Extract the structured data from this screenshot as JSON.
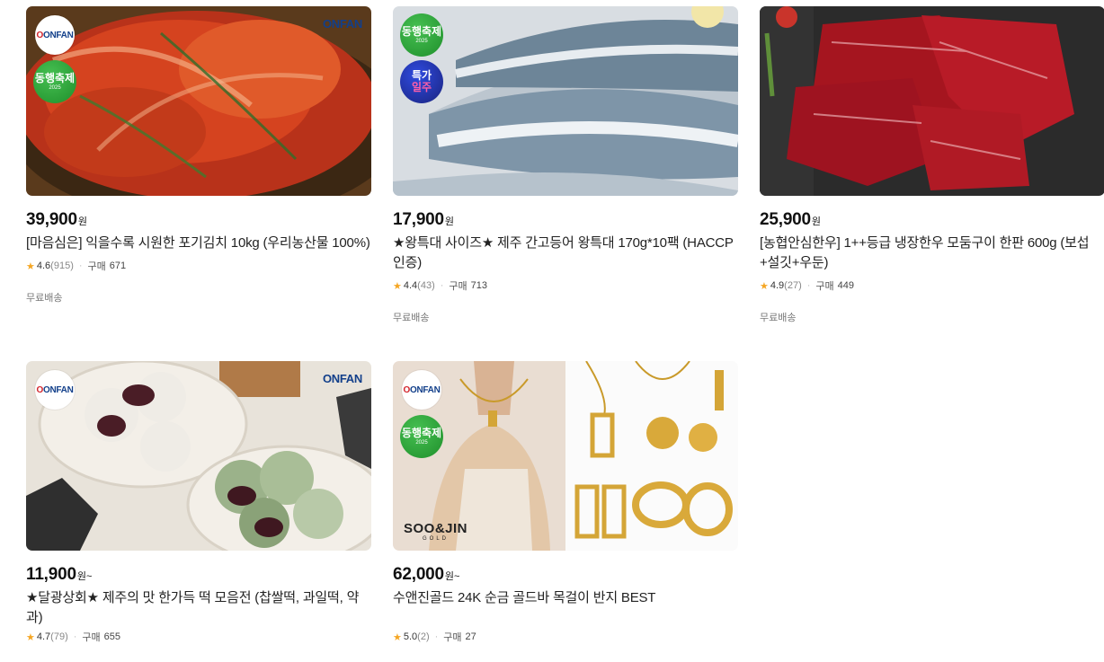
{
  "products": [
    {
      "price": "39,900",
      "unit": "원",
      "title": "[마음심은] 익을수록 시원한 포기김치 10kg (우리농산물 100%)",
      "rating": "4.6",
      "reviews": "(915)",
      "buy_label": "구매",
      "buy_count": "671",
      "shipping": "무료배송",
      "badges": {
        "onfan": "ONFAN",
        "dong": "동행축제",
        "dong_year": "2025",
        "watermark": "ONFAN"
      }
    },
    {
      "price": "17,900",
      "unit": "원",
      "title": "★왕특대 사이즈★ 제주 간고등어 왕특대 170g*10팩 (HACCP 인증)",
      "rating": "4.4",
      "reviews": "(43)",
      "buy_label": "구매",
      "buy_count": "713",
      "shipping": "무료배송",
      "badges": {
        "dong": "동행축제",
        "dong_year": "2025",
        "teuk_top": "특가",
        "teuk_bottom": "일주"
      }
    },
    {
      "price": "25,900",
      "unit": "원",
      "title": "[농협안심한우] 1++등급 냉장한우 모둠구이 한판 600g (보섭+설깃+우둔)",
      "rating": "4.9",
      "reviews": "(27)",
      "buy_label": "구매",
      "buy_count": "449",
      "shipping": "무료배송"
    },
    {
      "price": "11,900",
      "unit": "원~",
      "title": "★달광상회★ 제주의 맛 한가득 떡 모음전 (찹쌀떡, 과일떡, 약과)",
      "rating": "4.7",
      "reviews": "(79)",
      "buy_label": "구매",
      "buy_count": "655",
      "badges": {
        "onfan": "ONFAN",
        "watermark": "ONFAN"
      }
    },
    {
      "price": "62,000",
      "unit": "원~",
      "title": "수앤진골드 24K 순금 골드바 목걸이 반지 BEST",
      "rating": "5.0",
      "reviews": "(2)",
      "buy_label": "구매",
      "buy_count": "27",
      "badges": {
        "onfan": "ONFAN",
        "dong": "동행축제",
        "dong_year": "2025",
        "brand": "SOO&JIN",
        "brand_sub": "GOLD"
      }
    }
  ],
  "icons": {
    "rating": "star-icon"
  },
  "colors": {
    "star": "#f5a623",
    "onfan_blue": "#123f8a",
    "onfan_red": "#d3232b",
    "dong_green": "#2aa23a",
    "teuk_blue": "#1a237e"
  }
}
